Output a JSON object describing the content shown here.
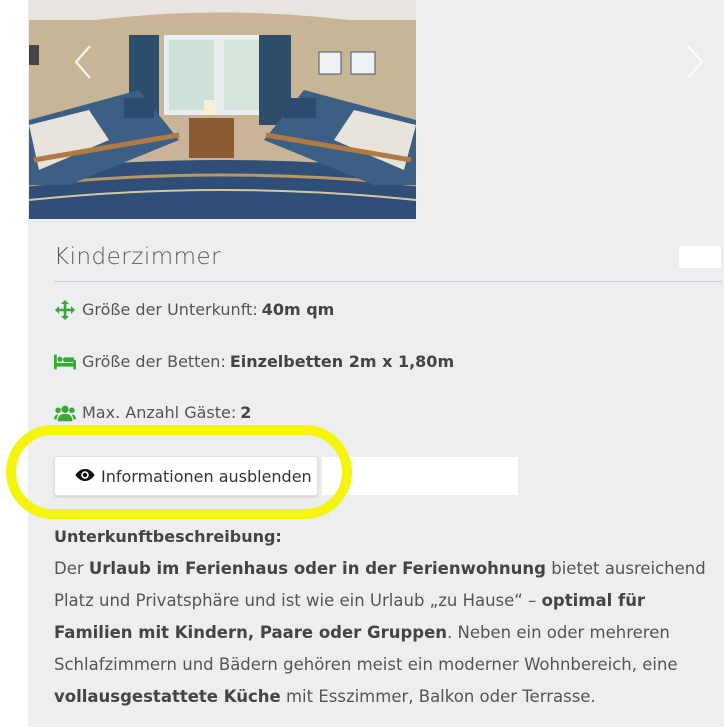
{
  "room": {
    "title": "Kinderzimmer",
    "features": [
      {
        "icon": "arrows-move-icon",
        "label": "Größe der Unterkunft:",
        "value": "40m qm"
      },
      {
        "icon": "bed-icon",
        "label": "Größe der Betten:",
        "value": "Einzelbetten 2m x 1,80m"
      },
      {
        "icon": "users-icon",
        "label": "Max. Anzahl Gäste:",
        "value": "2"
      }
    ]
  },
  "toggle_button": {
    "icon": "eye-icon",
    "label": "Informationen ausblenden"
  },
  "description": {
    "heading": "Unterkunftbeschreibung:",
    "p1": "Der ",
    "b1": "Urlaub im Ferienhaus oder in der Ferienwohnung",
    "p2": " bietet ausreichend Platz und Privatsphäre und ist wie ein Urlaub „zu Hause“ – ",
    "b2": "optimal für Familien mit Kindern, Paare oder Gruppen",
    "p3": ". Neben ein oder mehreren Schlafzimmern und Bädern gehören meist ein moderner Wohnbereich, eine ",
    "b3": "vollausgestattete Küche",
    "p4": " mit Esszimmer, Balkon oder Terrasse."
  },
  "colors": {
    "icon_green": "#3aa835",
    "highlight": "#f4f40e",
    "card_bg": "#eceef0"
  }
}
